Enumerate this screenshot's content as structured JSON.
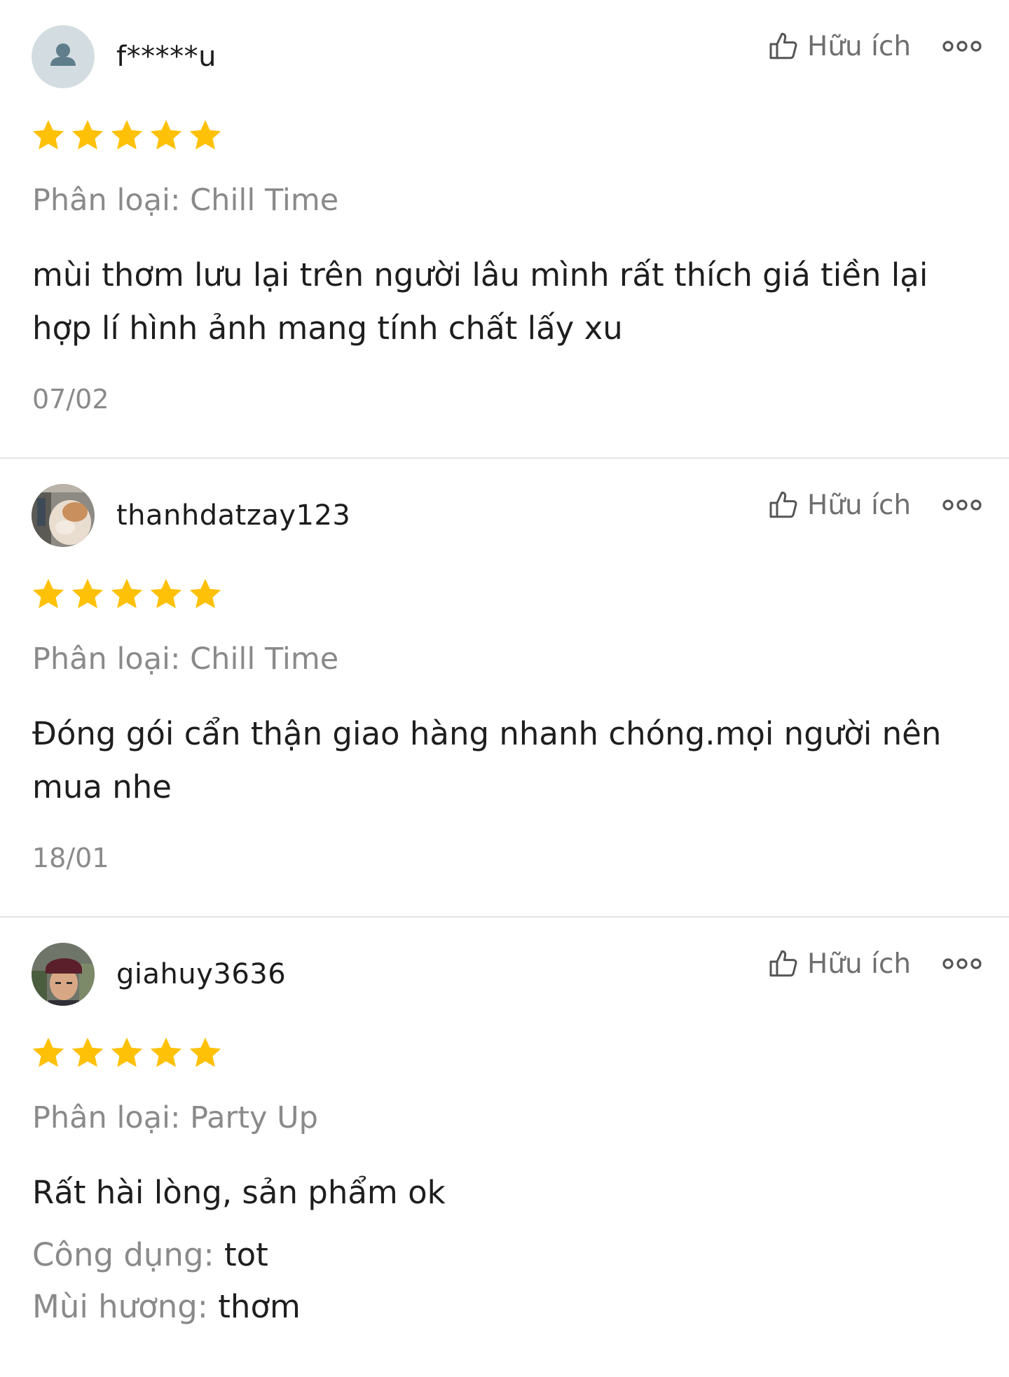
{
  "helpful_label": "Hữu ích",
  "colors": {
    "star": "#ffc107",
    "divider": "#e4e4e4",
    "muted_text": "#8a8a8a"
  },
  "icons": {
    "helpful": "thumbs-up-icon",
    "more": "more-options-icon",
    "star": "star-icon",
    "default_avatar": "user-icon"
  },
  "reviews": [
    {
      "username": "f*****u",
      "rating": 5,
      "variant": "Phân loại: Chill Time",
      "comment_line1": "mùi thơm lưu lại trên người lâu mình rất thích giá tiền lại",
      "comment_line2": "hợp lí hình ảnh mang tính chất lấy xu",
      "date": "07/02"
    },
    {
      "username": "thanhdatzay123",
      "rating": 5,
      "variant": "Phân loại: Chill Time",
      "comment_line1": "Đóng gói cẩn thận giao hàng nhanh chóng.mọi người nên",
      "comment_line2": "mua nhe",
      "date": "18/01"
    },
    {
      "username": "giahuy3636",
      "rating": 5,
      "variant": "Phân loại: Party Up",
      "comment_line1": "Rất hài lòng, sản phẩm ok",
      "attributes": [
        {
          "key": "Công dụng: ",
          "value": "tot"
        },
        {
          "key": "Mùi hương: ",
          "value": "thơm"
        }
      ]
    }
  ]
}
